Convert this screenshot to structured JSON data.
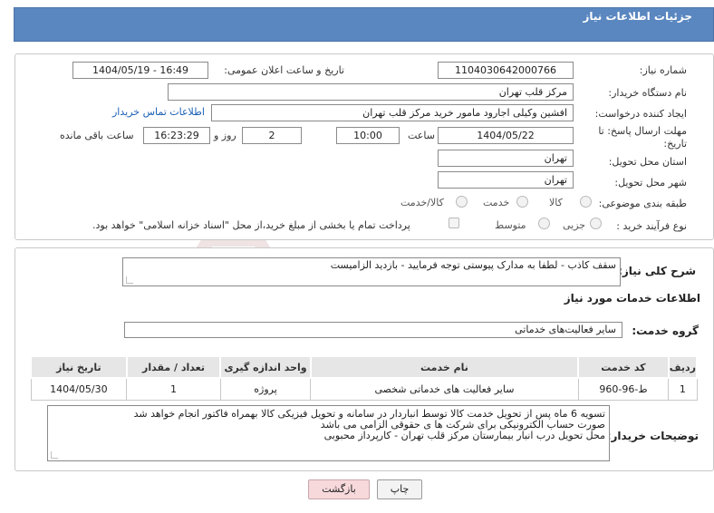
{
  "header": {
    "title": "جزئیات اطلاعات نیاز"
  },
  "form": {
    "need_number_label": "شماره نیاز:",
    "need_number": "1104030642000766",
    "announce_label": "تاریخ و ساعت اعلان عمومی:",
    "announce_value": "1404/05/19 - 16:49",
    "buyer_org_label": "نام دستگاه خریدار:",
    "buyer_org": "مرکز قلب تهران",
    "creator_label": "ایجاد کننده درخواست:",
    "creator": "افشین وکیلی اجارود مامور خرید مرکز قلب تهران",
    "contact_link": "اطلاعات تماس خریدار",
    "deadline_label": "مهلت ارسال پاسخ: تا تاریخ:",
    "deadline_date": "1404/05/22",
    "time_label": "ساعت",
    "deadline_time": "10:00",
    "days_value": "2",
    "days_label": "روز و",
    "remaining_time": "16:23:29",
    "remaining_label": "ساعت باقی مانده",
    "province_label": "استان محل تحویل:",
    "province": "تهران",
    "city_label": "شهر محل تحویل:",
    "city": "تهران",
    "category_label": "طبقه بندی موضوعی:",
    "category_options": [
      "کالا",
      "خدمت",
      "کالا/خدمت"
    ],
    "process_label": "نوع فرآیند خرید :",
    "process_options": [
      "جزیی",
      "متوسط"
    ],
    "payment_note": "پرداخت تمام یا بخشی از مبلغ خرید،از محل \"اسناد خزانه اسلامی\" خواهد بود."
  },
  "description": {
    "label": "شرح کلی نیاز:",
    "text": "سقف کاذب - لطفا به مدارک پیوستی توجه فرمایید - بازدید الزامیست"
  },
  "services": {
    "title": "اطلاعات خدمات مورد نیاز",
    "group_label": "گروه خدمت:",
    "group_value": "سایر فعالیت‌های خدماتی",
    "columns": [
      "ردیف",
      "کد خدمت",
      "نام خدمت",
      "واحد اندازه گیری",
      "تعداد / مقدار",
      "تاریخ نیاز"
    ],
    "rows": [
      [
        "1",
        "ط-96-960",
        "سایر فعالیت های خدماتی شخصی",
        "پروژه",
        "1",
        "1404/05/30"
      ]
    ]
  },
  "buyer_notes": {
    "label": "توضیحات خریدار:",
    "lines": [
      "تسویه 6 ماه پس از تحویل خدمت کالا توسط انباردار در سامانه و تحویل فیزیکی کالا بهمراه فاکتور انجام خواهد شد",
      "صورت حساب الکترونیکی برای شرکت ها ی حقوقی الزامی می باشد",
      "محل تحویل درب انبار بیمارستان مرکز قلب تهران - کارپرداز محبوبی"
    ]
  },
  "buttons": {
    "print": "چاپ",
    "back": "بازگشت"
  },
  "watermark": {
    "text": "AriaTender.net"
  },
  "colors": {
    "header_bg": "#5a87c0",
    "back_button_bg": "#f7d9dc",
    "link": "#1a5fb4"
  }
}
